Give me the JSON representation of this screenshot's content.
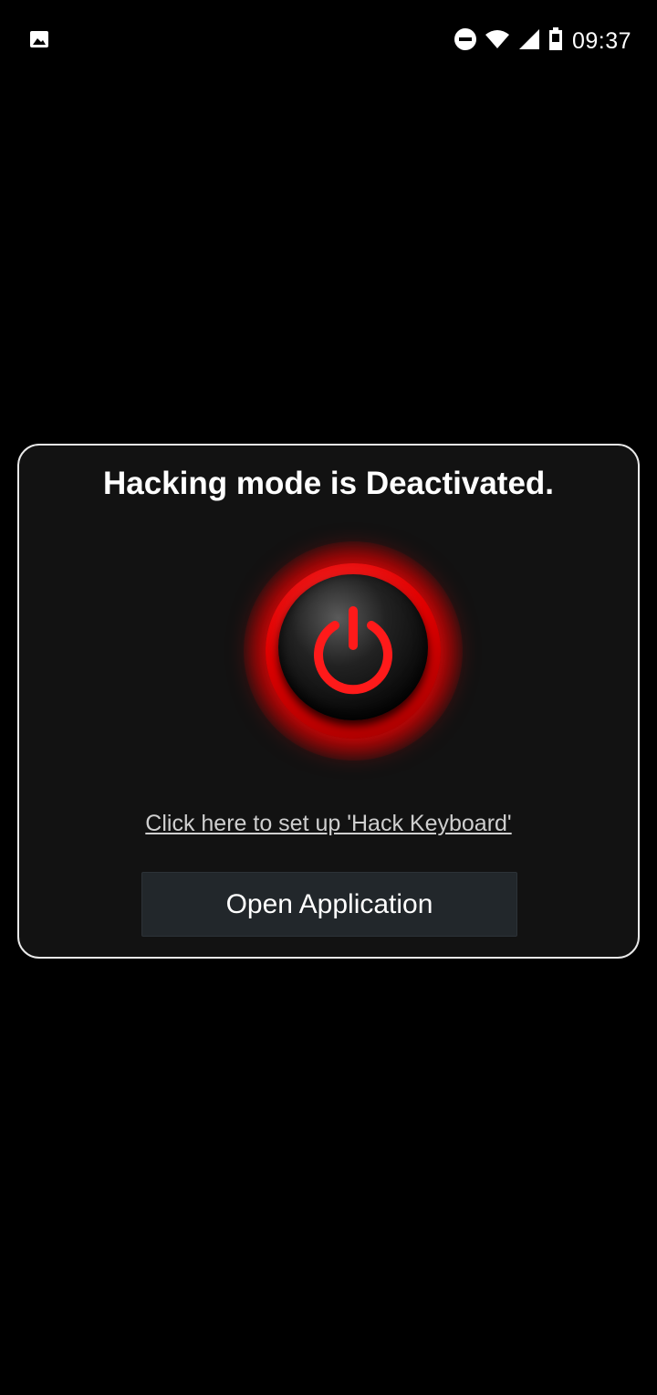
{
  "status_bar": {
    "time": "09:37",
    "icons": [
      "image-notification-icon",
      "do-not-disturb-icon",
      "wifi-icon",
      "cell-signal-icon",
      "battery-icon"
    ]
  },
  "dialog": {
    "title": "Hacking mode is Deactivated.",
    "power_button": {
      "icon": "power-icon",
      "color": "#ff1a1a"
    },
    "setup_link": "Click here to set up 'Hack Keyboard'",
    "open_button": "Open Application"
  },
  "colors": {
    "background": "#000000",
    "dialog_background": "#121212",
    "dialog_border": "#e9e9e9",
    "accent_red": "#ff1a1a",
    "button_background": "#22272b"
  }
}
